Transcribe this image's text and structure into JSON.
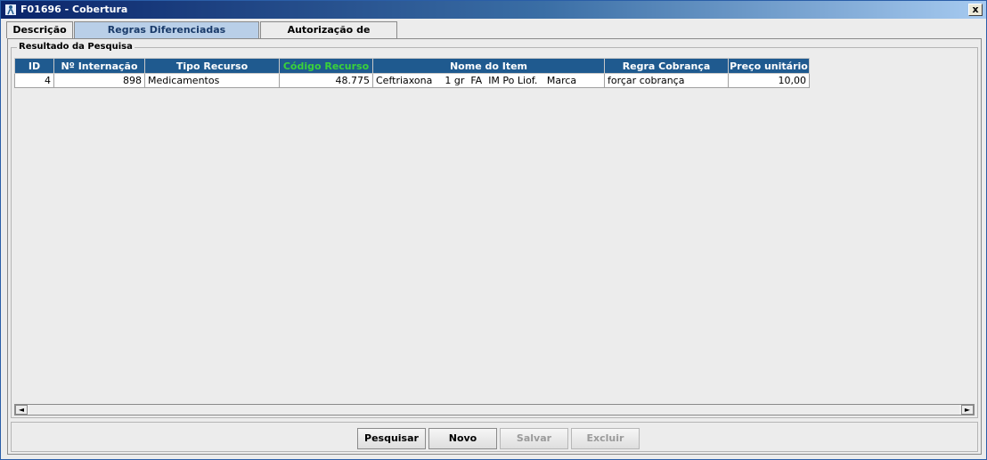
{
  "window": {
    "title": "F01696 - Cobertura",
    "close_label": "x"
  },
  "tabs": [
    {
      "label": "Descrição",
      "active": false
    },
    {
      "label": "Regras Diferenciadas Faturamento",
      "active": true
    },
    {
      "label": "Autorização de Recursos",
      "active": false
    }
  ],
  "results": {
    "group_label": "Resultado da Pesquisa",
    "columns": [
      "ID",
      "Nº Internação",
      "Tipo Recurso",
      "Código Recurso",
      "Nome do Item",
      "Regra Cobrança",
      "Preço unitário"
    ],
    "highlight_column": "Código Recurso",
    "rows": [
      {
        "id": "4",
        "internacao": "898",
        "tipo_recurso": "Medicamentos",
        "codigo_recurso": "48.775",
        "nome_item": "Ceftriaxona    1 gr  FA  IM Po Liof.   Marca",
        "regra_cobranca": "forçar cobrança",
        "preco_unitario": "10,00"
      }
    ]
  },
  "scrollbar": {
    "left": "◄",
    "right": "►"
  },
  "buttons": {
    "pesquisar": {
      "label": "Pesquisar",
      "enabled": true
    },
    "novo": {
      "label": "Novo",
      "enabled": true
    },
    "salvar": {
      "label": "Salvar",
      "enabled": false
    },
    "excluir": {
      "label": "Excluir",
      "enabled": false
    }
  },
  "colors": {
    "title_bar": "#0a246a",
    "header_bg": "#1f5a8f",
    "header_highlight_text": "#3ad23a",
    "active_tab_bg": "#b9cfe8"
  }
}
